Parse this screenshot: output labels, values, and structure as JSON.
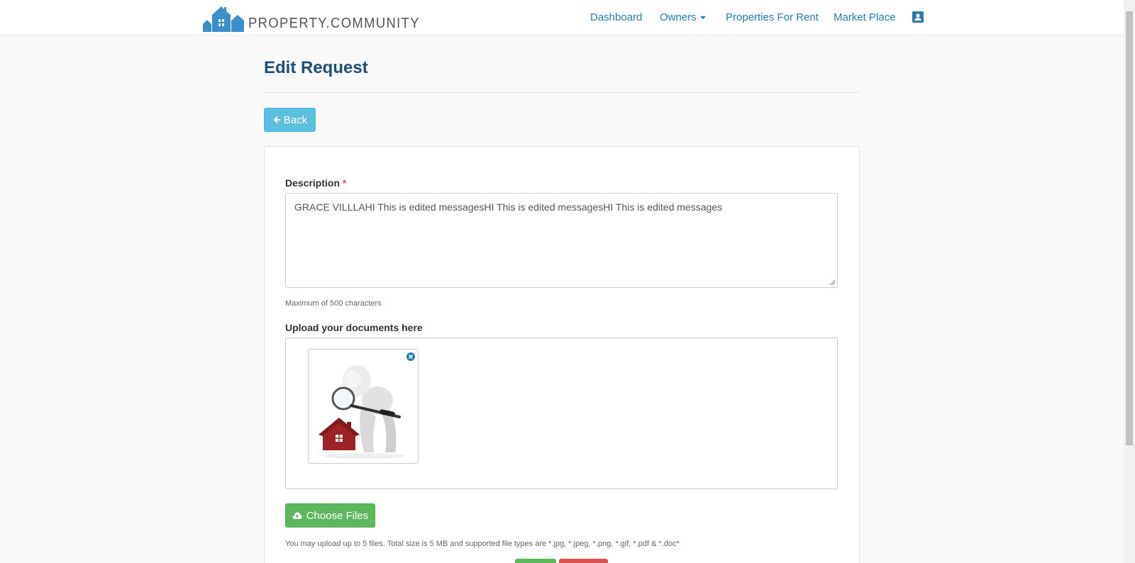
{
  "brand": {
    "name": "PROPERTY.COMMUNITY",
    "logo_icon": "house-logo-icon"
  },
  "nav": {
    "items": [
      {
        "label": "Dashboard"
      },
      {
        "label": "Owners"
      },
      {
        "label": "Properties For Rent"
      },
      {
        "label": "Market Place"
      }
    ],
    "profile_icon": "contact-card-icon"
  },
  "page": {
    "title": "Edit Request",
    "back_label": "Back"
  },
  "form": {
    "description_label": "Description",
    "required_mark": "*",
    "description_value": "GRACE VILLLAHI This is edited messagesHI This is edited messagesHI This is edited messages",
    "description_help": "Maximum of 500 characters",
    "upload_label": "Upload your documents here",
    "choose_files_label": "Choose Files",
    "upload_help": "You may upload up to 5 files. Total size is 5 MB and supported file types are *.jpg, *.jpeg, *.png, *.gif, *.pdf & *.doc*"
  },
  "colors": {
    "accent": "#2a7ab0",
    "title": "#1f4e79",
    "back_button": "#5bc0de",
    "choose_button": "#5cb85c",
    "cancel_button": "#d9534f"
  }
}
